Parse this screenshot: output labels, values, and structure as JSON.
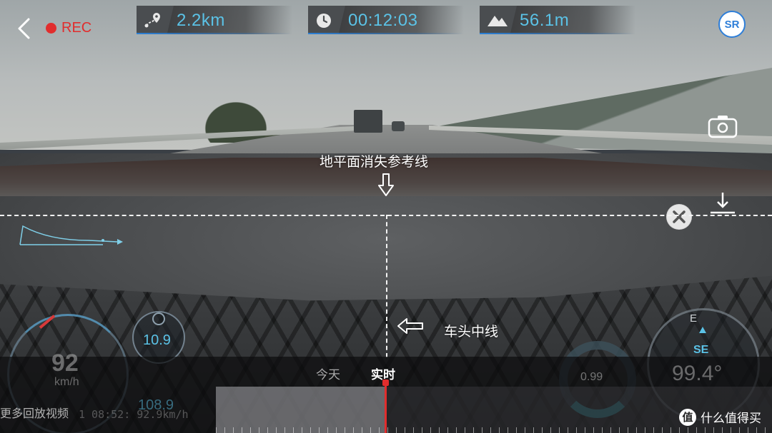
{
  "top_bar": {
    "rec_label": "REC",
    "logo_text": "SR",
    "stats": {
      "distance": {
        "icon": "route-pin-icon",
        "value": "2.2km"
      },
      "duration": {
        "icon": "clock-icon",
        "value": "00:12:03"
      },
      "altitude": {
        "icon": "mountain-icon",
        "value": "56.1m"
      }
    }
  },
  "guides": {
    "horizon_label": "地平面消失参考线",
    "center_label": "车头中线"
  },
  "gauges": {
    "speed_value": "92",
    "speed_unit": "km/h",
    "g_value": "10.9",
    "g_value_ghost": "108.9",
    "ring_value": "0.99",
    "compass_letter": "E",
    "compass_direction": "SE",
    "heading_value": "99.4°"
  },
  "playback": {
    "tab_today": "今天",
    "tab_live": "实时",
    "more_videos": "更多回放视频",
    "overlay_stamp": "1 08:52:  92.9km/h",
    "elapsed_fraction": 0.306
  },
  "watermark": {
    "badge": "值",
    "text": "什么值得买"
  },
  "colors": {
    "accent": "#5bc2e6",
    "record": "#e12d2d",
    "brand": "#2e7ed8"
  }
}
